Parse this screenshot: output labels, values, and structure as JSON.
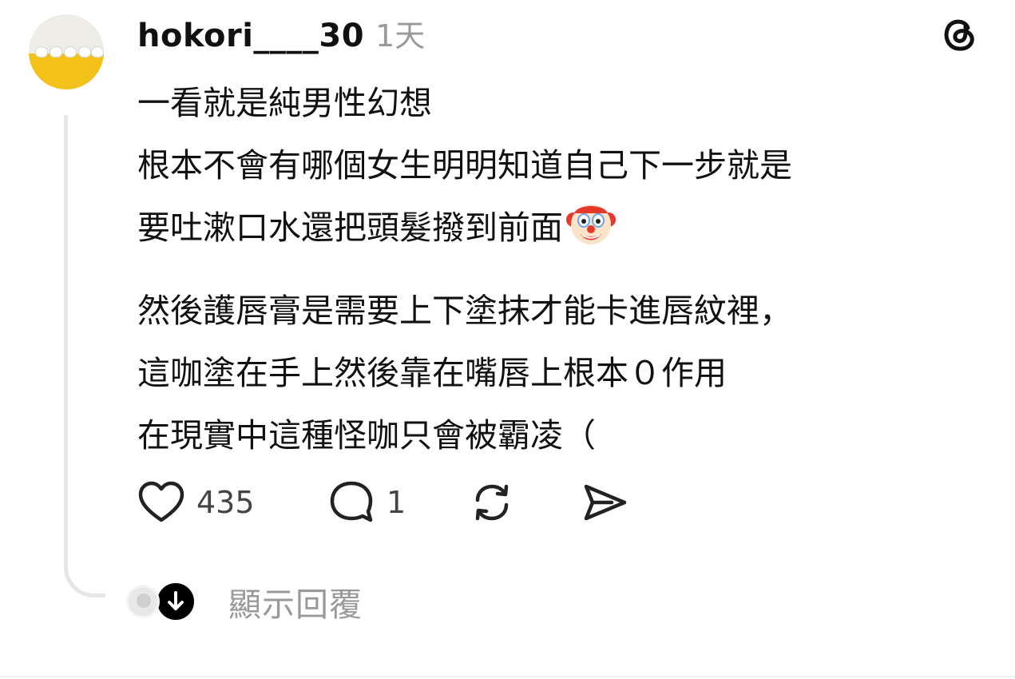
{
  "post": {
    "username": "hokori____30",
    "timestamp": "1天",
    "body": {
      "paragraph1": [
        "一看就是純男性幻想",
        "根本不會有哪個女生明明知道自己下一步就是",
        "要吐漱口水還把頭髮撥到前面"
      ],
      "paragraph2": [
        "然後護唇膏是需要上下塗抹才能卡進唇紋裡，",
        "這咖塗在手上然後靠在嘴唇上根本０作用",
        "在現實中這種怪咖只會被霸凌（"
      ],
      "emoji": "clown-face"
    },
    "actions": {
      "likes": "435",
      "replies": "1"
    },
    "show_replies_label": "顯示回覆"
  },
  "icons": {
    "brand": "threads-logo",
    "like": "heart-icon",
    "reply": "comment-icon",
    "repost": "repost-icon",
    "share": "send-icon",
    "expand": "arrow-down-icon"
  },
  "colors": {
    "text": "#111111",
    "muted": "#999999",
    "thread_line": "#e6e6e6",
    "avatar_yellow": "#f2c21a"
  }
}
